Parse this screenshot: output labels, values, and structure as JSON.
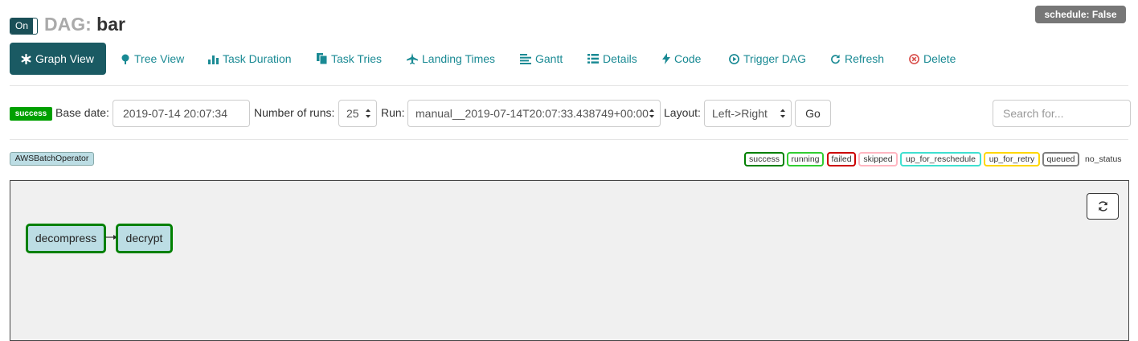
{
  "header": {
    "toggle_label": "On",
    "title_prefix": "DAG:",
    "dag_id": "bar",
    "schedule_badge": "schedule: False"
  },
  "nav": {
    "items": [
      {
        "label": "Graph View",
        "icon": "asterisk-icon"
      },
      {
        "label": "Tree View",
        "icon": "tree-icon"
      },
      {
        "label": "Task Duration",
        "icon": "bar-chart-icon"
      },
      {
        "label": "Task Tries",
        "icon": "files-icon"
      },
      {
        "label": "Landing Times",
        "icon": "plane-icon"
      },
      {
        "label": "Gantt",
        "icon": "align-left-icon"
      },
      {
        "label": "Details",
        "icon": "list-icon"
      },
      {
        "label": "Code",
        "icon": "flash-icon"
      },
      {
        "label": "Trigger DAG",
        "icon": "play-circle-icon"
      },
      {
        "label": "Refresh",
        "icon": "refresh-icon"
      },
      {
        "label": "Delete",
        "icon": "remove-circle-icon"
      }
    ]
  },
  "form": {
    "status_badge": "success",
    "base_date_label": "Base date:",
    "base_date_value": "2019-07-14 20:07:34",
    "num_runs_label": "Number of runs:",
    "num_runs_value": "25",
    "run_label": "Run:",
    "run_value": "manual__2019-07-14T20:07:33.438749+00:00",
    "layout_label": "Layout:",
    "layout_value": "Left->Right",
    "go_label": "Go",
    "search_placeholder": "Search for..."
  },
  "legend": {
    "operator": "AWSBatchOperator",
    "states": [
      {
        "label": "success",
        "color": "#008000"
      },
      {
        "label": "running",
        "color": "#32cd32"
      },
      {
        "label": "failed",
        "color": "#cc0000"
      },
      {
        "label": "skipped",
        "color": "#ffb6c1"
      },
      {
        "label": "up_for_reschedule",
        "color": "#40e0d0"
      },
      {
        "label": "up_for_retry",
        "color": "#ffd700"
      },
      {
        "label": "queued",
        "color": "#808080"
      }
    ],
    "no_status": "no_status"
  },
  "graph": {
    "nodes": [
      {
        "label": "decompress",
        "state": "success"
      },
      {
        "label": "decrypt",
        "state": "success"
      }
    ]
  },
  "colors": {
    "accent": "#1a5a63",
    "link": "#1a8a94",
    "node_fill": "#bcdde4"
  }
}
